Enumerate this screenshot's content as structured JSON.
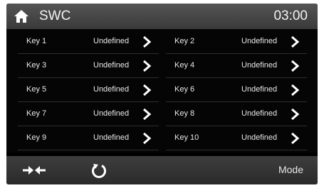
{
  "header": {
    "title": "SWC",
    "time": "03:00",
    "home_icon": "home-icon"
  },
  "keys": [
    {
      "label": "Key 1",
      "value": "Undefined"
    },
    {
      "label": "Key 2",
      "value": "Undefined"
    },
    {
      "label": "Key 3",
      "value": "Undefined"
    },
    {
      "label": "Key 4",
      "value": "Undefined"
    },
    {
      "label": "Key 5",
      "value": "Undefined"
    },
    {
      "label": "Key 6",
      "value": "Undefined"
    },
    {
      "label": "Key 7",
      "value": "Undefined"
    },
    {
      "label": "Key 8",
      "value": "Undefined"
    },
    {
      "label": "Key 9",
      "value": "Undefined"
    },
    {
      "label": "Key 10",
      "value": "Undefined"
    }
  ],
  "footer": {
    "swap_icon": "swap-arrows-icon",
    "reset_icon": "reset-icon",
    "mode_label": "Mode"
  },
  "colors": {
    "background": "#000000",
    "header": "#4a4a4a",
    "text": "#e8e8e8"
  }
}
